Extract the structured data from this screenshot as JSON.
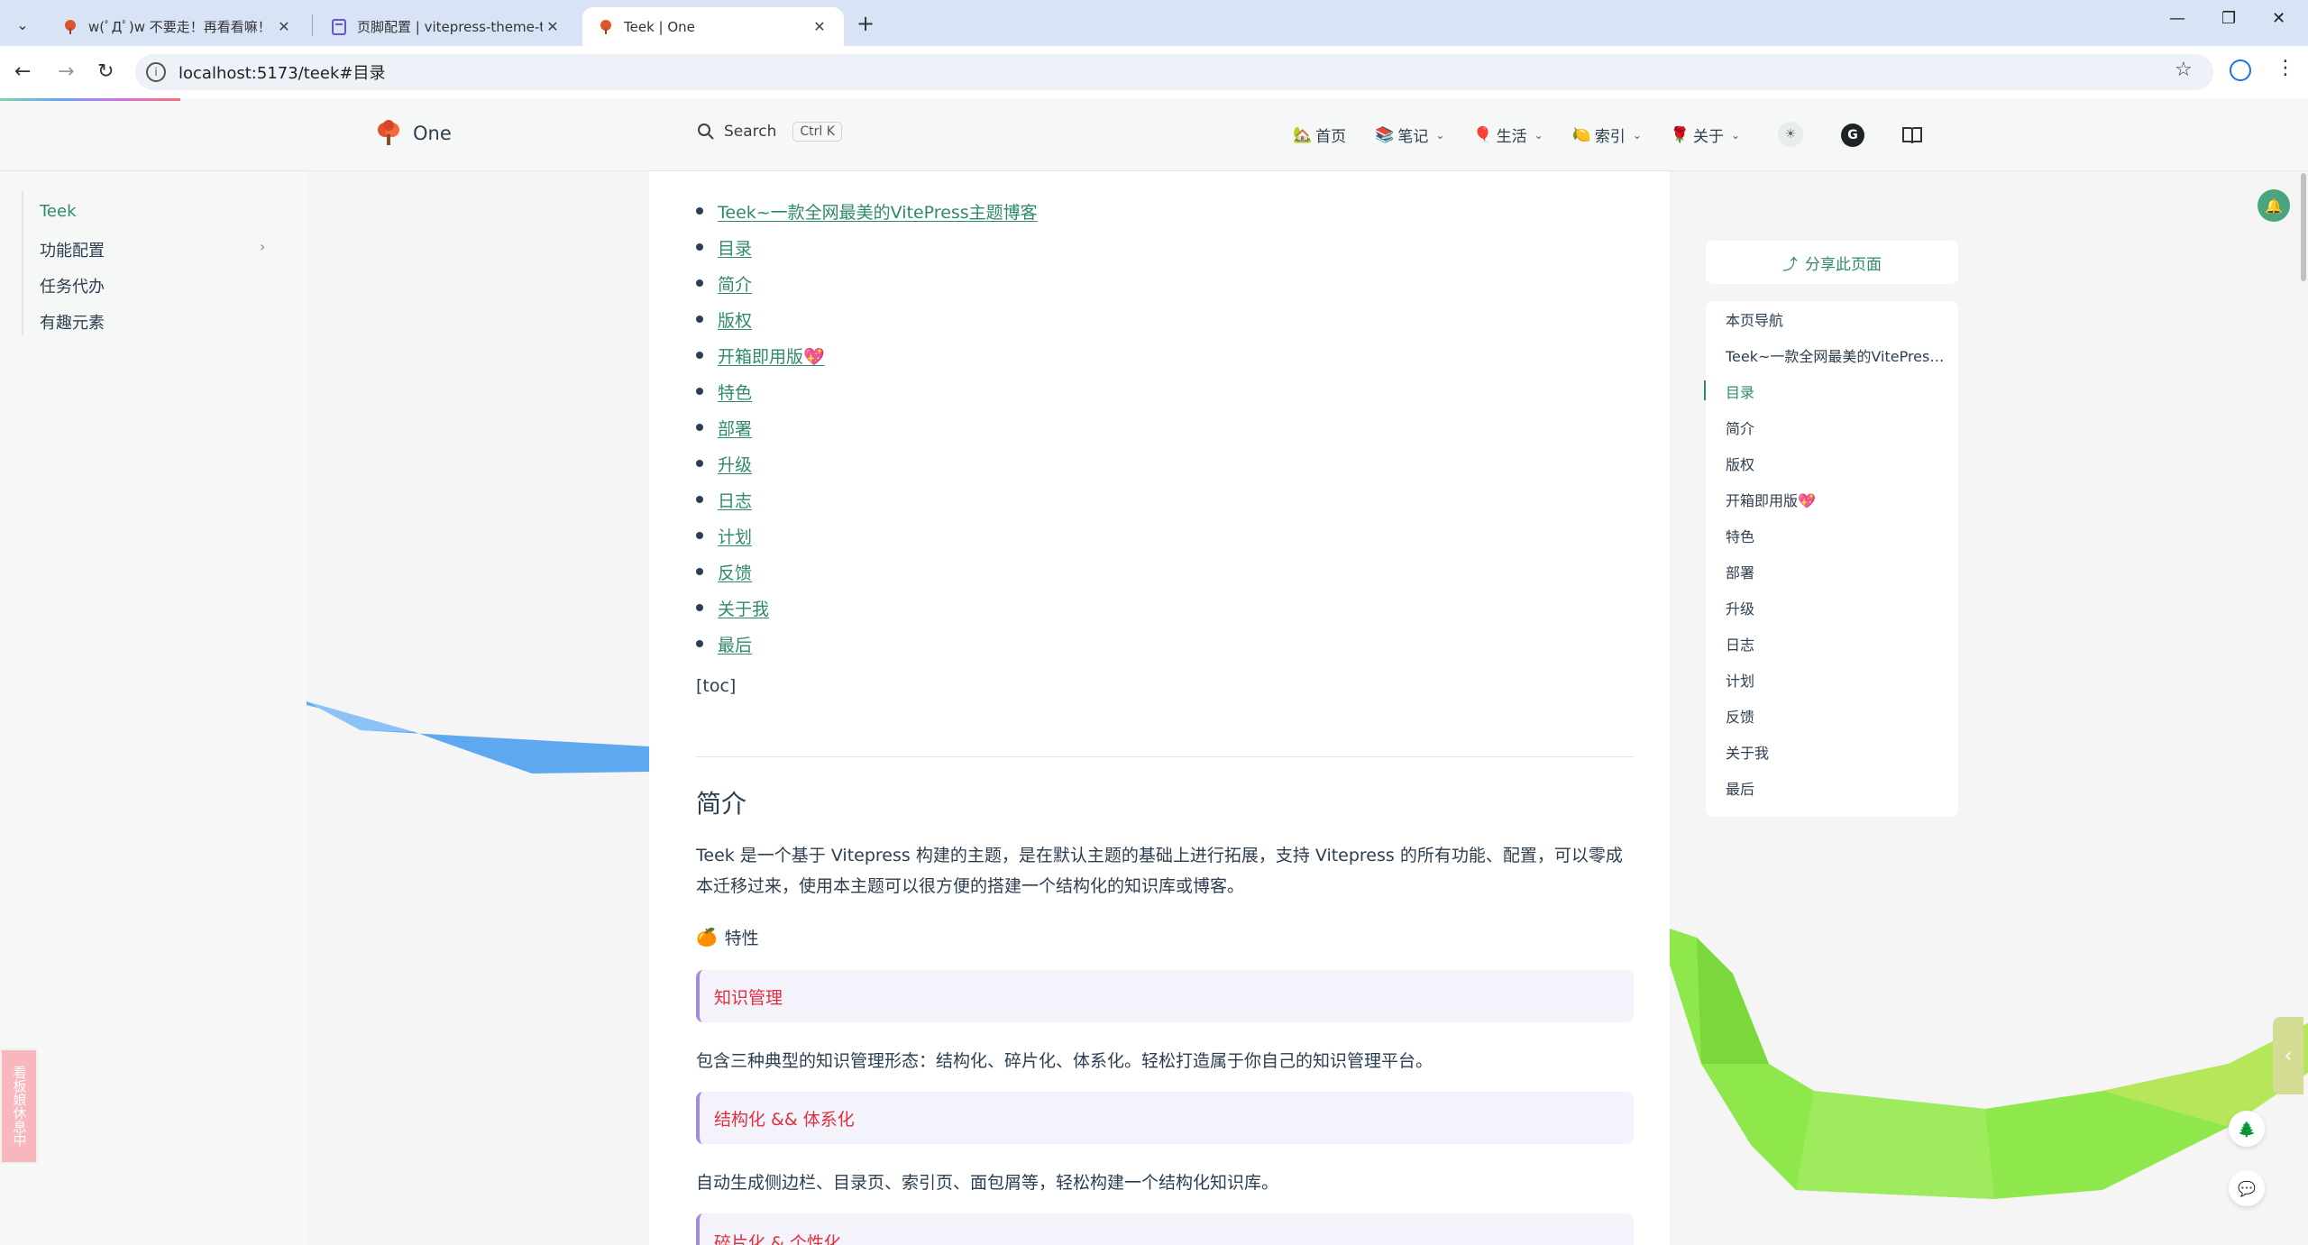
{
  "browser": {
    "tabs": [
      {
        "title": "w(ﾟДﾟ)w 不要走！再看看嘛！",
        "active": false
      },
      {
        "title": "页脚配置 | vitepress-theme-te",
        "active": false
      },
      {
        "title": "Teek | One",
        "active": true
      }
    ],
    "new_tab": "+",
    "url": "localhost:5173/teek#目录"
  },
  "site": {
    "logo_text": "One",
    "search_label": "Search",
    "search_kbd": "Ctrl K",
    "nav": [
      {
        "emoji": "🏡",
        "label": "首页",
        "dropdown": false
      },
      {
        "emoji": "📚",
        "label": "笔记",
        "dropdown": true
      },
      {
        "emoji": "🎈",
        "label": "生活",
        "dropdown": true
      },
      {
        "emoji": "🍋",
        "label": "索引",
        "dropdown": true
      },
      {
        "emoji": "🌹",
        "label": "关于",
        "dropdown": true
      }
    ]
  },
  "sidebar": {
    "items": [
      {
        "label": "Teek",
        "active": true
      },
      {
        "label": "功能配置",
        "active": false
      },
      {
        "label": "任务代办",
        "active": false
      },
      {
        "label": "有趣元素",
        "active": false
      }
    ]
  },
  "content": {
    "toc": [
      "Teek~一款全网最美的VitePress主题博客",
      "目录",
      "简介",
      "版权",
      "开箱即用版💖",
      "特色",
      "部署",
      "升级",
      "日志",
      "计划",
      "反馈",
      "关于我",
      "最后"
    ],
    "toc_marker": "[toc]",
    "section_title": "简介",
    "intro": "Teek 是一个基于 Vitepress 构建的主题，是在默认主题的基础上进行拓展，支持 Vitepress 的所有功能、配置，可以零成本迁移过来，使用本主题可以很方便的搭建一个结构化的知识库或博客。",
    "features_emoji": "🍊",
    "features_label": "特性",
    "callouts": [
      {
        "title": "知识管理",
        "text": "包含三种典型的知识管理形态：结构化、碎片化、体系化。轻松打造属于你自己的知识管理平台。"
      },
      {
        "title": "结构化 && 体系化",
        "text": "自动生成侧边栏、目录页、索引页、面包屑等，轻松构建一个结构化知识库。"
      },
      {
        "title": "碎片化 & 个性化",
        "text": ""
      }
    ]
  },
  "aside": {
    "share_label": "分享此页面",
    "outline": [
      "本页导航",
      "Teek~一款全网最美的VitePress主题博客",
      "目录",
      "简介",
      "版权",
      "开箱即用版💖",
      "特色",
      "部署",
      "升级",
      "日志",
      "计划",
      "反馈",
      "关于我",
      "最后"
    ],
    "active_index": 2
  },
  "widgets": {
    "rest_label": "看板娘休息中"
  },
  "colors": {
    "accent": "#2f8a6a",
    "callout_title": "#e0303e",
    "callout_border": "#a78bdb"
  }
}
